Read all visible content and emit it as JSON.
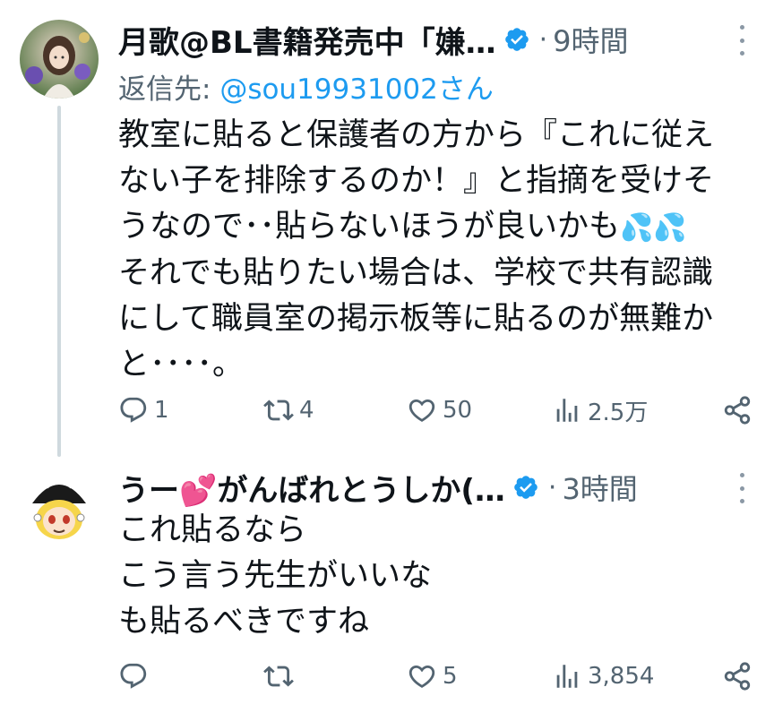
{
  "tweets": [
    {
      "name": "月歌@BL書籍発売中「嫌…",
      "time": "9時間",
      "reply_to_label": "返信先: ",
      "reply_to_handle": "@sou19931002さん",
      "lines": [
        "教室に貼ると保護者の方から『これに従え",
        "ない子を排除するのか！』と指摘を受けそ",
        "うなので･･貼らないほうが良いかも",
        "それでも貼りたい場合は、学校で共有認識",
        "にして職員室の掲示板等に貼るのが無難か",
        "と････。"
      ],
      "sweat_emoji": "💦💦",
      "stats": {
        "replies": "1",
        "retweets": "4",
        "likes": "50",
        "views": "2.5万"
      }
    },
    {
      "name_prefix": "うー",
      "name_emoji": "💕",
      "name_suffix": "がんばれとうしか(…",
      "time": "3時間",
      "lines": [
        "これ貼るなら",
        "こう言う先生がいいな",
        "も貼るべきですね"
      ],
      "stats": {
        "replies": "",
        "retweets": "",
        "likes": "5",
        "views": "3,854"
      }
    }
  ],
  "separator": "·",
  "icons": [
    "reply-icon",
    "retweet-icon",
    "like-icon",
    "views-icon",
    "share-icon",
    "verified-badge-icon",
    "more-icon"
  ],
  "colors": {
    "accent": "#1d9bf0",
    "secondary_text": "#536471",
    "thread_line": "#cfd9de"
  }
}
